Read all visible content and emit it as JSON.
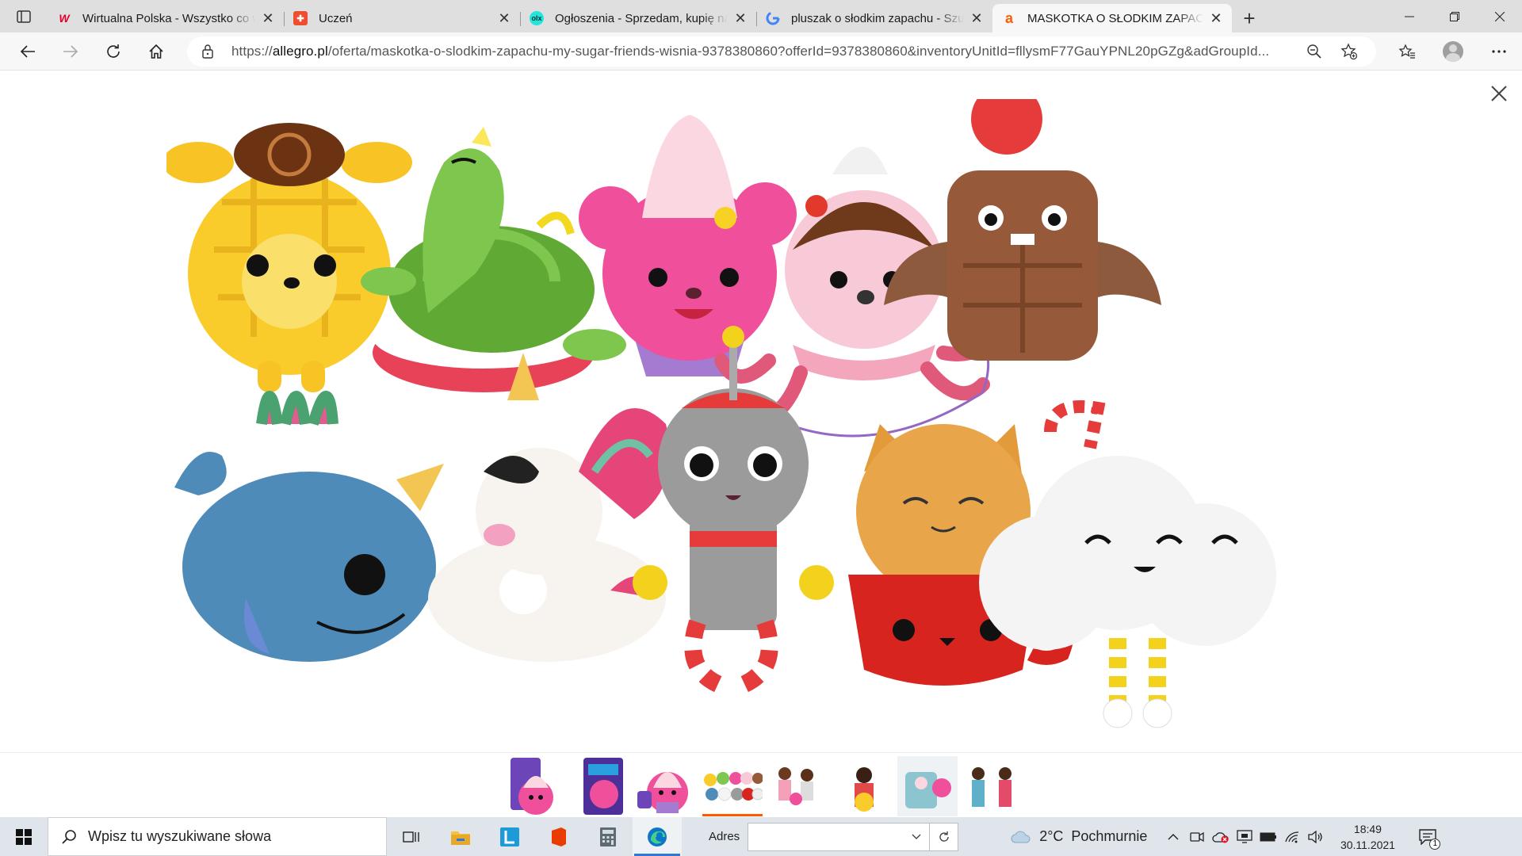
{
  "browser": {
    "tabs": [
      {
        "title": "Wirtualna Polska - Wszystko co ważne",
        "favicon": "wp-favicon",
        "active": false
      },
      {
        "title": "Uczeń",
        "favicon": "librus-favicon",
        "active": false
      },
      {
        "title": "Ogłoszenia - Sprzedam, kupię na OLX",
        "favicon": "olx-favicon",
        "active": false
      },
      {
        "title": "pluszak o słodkim zapachu - Szukaj",
        "favicon": "google-favicon",
        "active": false
      },
      {
        "title": "MASKOTKA O SŁODKIM ZAPACHU",
        "favicon": "allegro-favicon",
        "active": true
      }
    ],
    "url_prefix": "https://",
    "url_domain": "allegro.pl",
    "url_path": "/oferta/maskotka-o-slodkim-zapachu-my-sugar-friends-wisnia-9378380860?offerId=9378380860&inventoryUnitId=fllysmF77GauYPNL20pGZg&adGroupId..."
  },
  "viewer": {
    "thumbnail_count": 8,
    "selected_thumbnail": 3
  },
  "taskbar": {
    "search_placeholder": "Wpisz tu wyszukiwane słowa",
    "address_label": "Adres",
    "weather": "2°C  Pochmurnie",
    "time": "18:49",
    "date": "30.11.2021",
    "notification_count": "1"
  },
  "colors": {
    "allegro_orange": "#ff5a00",
    "wp_red": "#e4002b",
    "edge_blue": "#2b7bd6"
  }
}
